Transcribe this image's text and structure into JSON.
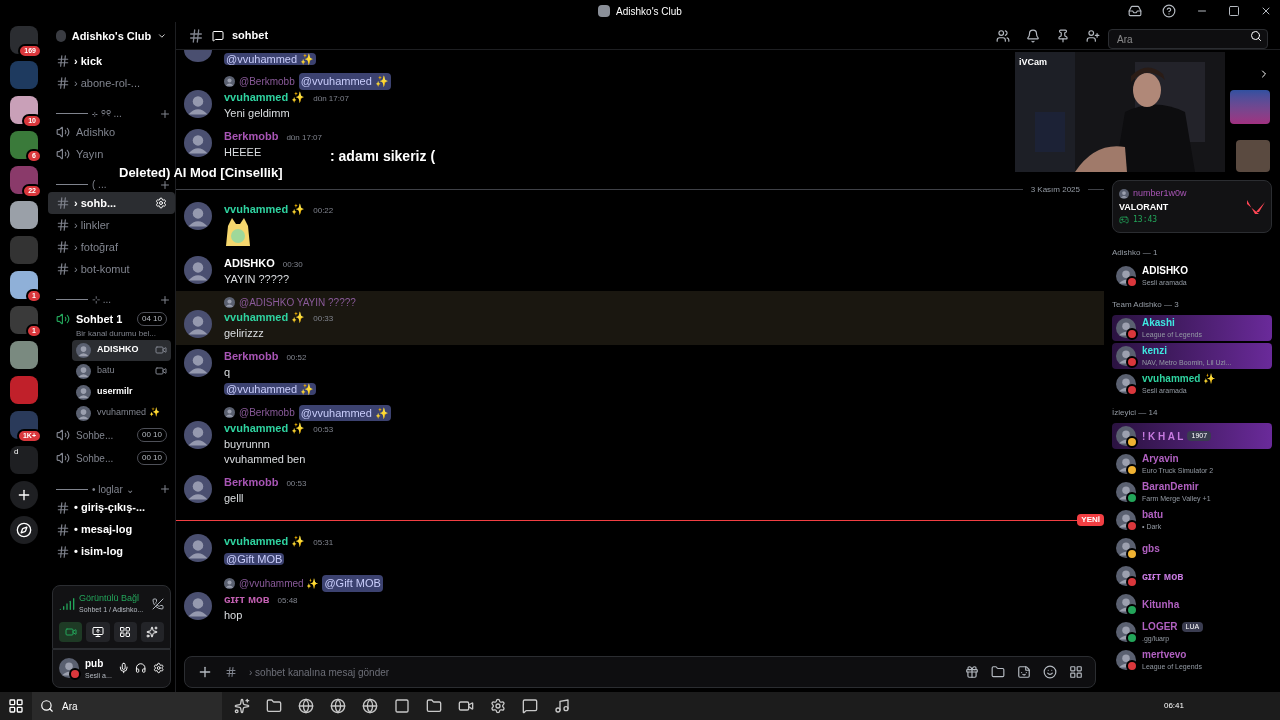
{
  "window": {
    "title": "Adishko's Club"
  },
  "servers": [
    {
      "badge": "169",
      "color": "#2b2d31"
    },
    {
      "color": "#1e3a5f"
    },
    {
      "badge": "10",
      "color": "#c9a0b8"
    },
    {
      "badge": "6",
      "color": "#3a7a3a"
    },
    {
      "badge": "22",
      "color": "#8a3a6a"
    },
    {
      "color": "#9aa0a8"
    },
    {
      "color": "#333333"
    },
    {
      "badge": "1",
      "color": "#8fb0d8"
    },
    {
      "badge": "1",
      "color": "#3a3a3a"
    },
    {
      "color": "#7a8a80"
    },
    {
      "color": "#c0202a"
    },
    {
      "badge": "1K+",
      "color": "#2a3a5a"
    }
  ],
  "folder_label": "d",
  "server_name": "Adishko's Club",
  "channels": [
    {
      "kind": "text",
      "name": "› kick",
      "bold": true,
      "selected": false
    },
    {
      "kind": "text",
      "name": "› abone-rol-...",
      "bold": false,
      "selected": false
    },
    {
      "kind": "category",
      "name": "⊹ ୨୧ ..."
    },
    {
      "kind": "voice",
      "name": "Adishko",
      "bold": false,
      "selected": false
    },
    {
      "kind": "voice",
      "name": "Yayın",
      "bold": false,
      "selected": false
    },
    {
      "kind": "category",
      "name": "( ..."
    },
    {
      "kind": "text",
      "name": "› sohb...",
      "bold": true,
      "selected": true
    },
    {
      "kind": "text",
      "name": "› linkler",
      "bold": false,
      "selected": false
    },
    {
      "kind": "text",
      "name": "› fotoğraf",
      "bold": false,
      "selected": false
    },
    {
      "kind": "text",
      "name": "› bot-komut",
      "bold": false,
      "selected": false
    },
    {
      "kind": "category",
      "name": "⊹ ..."
    },
    {
      "kind": "voicelive",
      "name": "Sohbet 1",
      "status": "Bir kanal durumu bel...",
      "count": "04",
      "limit": "10"
    },
    {
      "kind": "member",
      "name": "ADISHKO",
      "bold": true,
      "selected": true,
      "camera": true
    },
    {
      "kind": "member",
      "name": "batu",
      "bold": false,
      "selected": false,
      "camera": true
    },
    {
      "kind": "member",
      "name": "usermilr",
      "bold": true,
      "selected": false,
      "camera": false
    },
    {
      "kind": "member",
      "name": "vvuhammed ✨",
      "bold": false,
      "selected": false,
      "camera": false
    },
    {
      "kind": "voicecount",
      "name": "Sohbe...",
      "count": "00",
      "limit": "10"
    },
    {
      "kind": "voicecount",
      "name": "Sohbe...",
      "count": "00",
      "limit": "10"
    },
    {
      "kind": "category",
      "name": "• loglar ⌄"
    },
    {
      "kind": "text",
      "name": "• giriş-çıkış-...",
      "bold": true,
      "selected": false
    },
    {
      "kind": "text",
      "name": "• mesaj-log",
      "bold": true,
      "selected": false
    },
    {
      "kind": "text",
      "name": "• isim-log",
      "bold": true,
      "selected": false
    }
  ],
  "voice_panel": {
    "status": "Görüntülü Bağl",
    "channel": "Sohbet 1 / Adishko..."
  },
  "user": {
    "name": "pub",
    "status": "Sesli a..."
  },
  "header": {
    "channel": "sohbet",
    "search_placeholder": "Ara"
  },
  "messages": [
    {
      "kind": "message",
      "mention": "@vvuhammed ✨"
    },
    {
      "kind": "message",
      "reply": {
        "author": "@Berkmobb",
        "mention": "@vvuhammed ✨"
      },
      "author": "vvuhammed ✨",
      "color": "#2fd3a0",
      "time": "dün 17:07",
      "lines": [
        "Yeni geldimm"
      ]
    },
    {
      "kind": "message",
      "author": "Berkmobb",
      "color": "#a855b5",
      "time": "dün 17:07",
      "lines": [
        "HEEEE"
      ]
    },
    {
      "kind": "divider",
      "text": "3 Kasım 2025"
    },
    {
      "kind": "message",
      "author": "vvuhammed ✨",
      "color": "#2fd3a0",
      "time": "00:22",
      "sticker": true
    },
    {
      "kind": "message",
      "author": "ADISHKO",
      "color": "#ffffff",
      "time": "00:30",
      "lines": [
        "YAYIN ?????"
      ]
    },
    {
      "kind": "message",
      "reply": {
        "author": "@ADISHKO YAYIN ?????"
      },
      "author": "vvuhammed ✨",
      "color": "#2fd3a0",
      "time": "00:33",
      "lines": [
        "gelirizzz"
      ],
      "highlighted": true
    },
    {
      "kind": "message",
      "author": "Berkmobb",
      "color": "#a855b5",
      "time": "00:52",
      "lines": [
        "q"
      ],
      "mention": "@vvuhammed ✨"
    },
    {
      "kind": "message",
      "reply": {
        "author": "@Berkmobb",
        "mention": "@vvuhammed ✨"
      },
      "author": "vvuhammed ✨",
      "color": "#2fd3a0",
      "time": "00:53",
      "lines": [
        "buyrunnn",
        "vvuhammed ben"
      ]
    },
    {
      "kind": "message",
      "author": "Berkmobb",
      "color": "#a855b5",
      "time": "00:53",
      "lines": [
        "gelll"
      ]
    },
    {
      "kind": "new",
      "text": "YENİ"
    },
    {
      "kind": "message",
      "author": "vvuhammed ✨",
      "color": "#2fd3a0",
      "time": "05:31",
      "mention": "@Gift MOB"
    },
    {
      "kind": "message",
      "reply": {
        "author": "@vvuhammed ✨",
        "mention": "@Gift MOB"
      },
      "author": "ɢɪғᴛ ᴍᴏʙ",
      "color": "#c15fb0",
      "time": "05:48",
      "lines": [
        "hop"
      ]
    }
  ],
  "composer": {
    "placeholder": "› sohbet kanalına mesaj gönder"
  },
  "overlay": {
    "line1": ": adamı sikeriz (",
    "line2": "Deleted) AI Mod [Cinsellik]"
  },
  "webcam": {
    "label": "iVCam"
  },
  "activity": {
    "user": "number1w0w",
    "game": "VALORANT",
    "time": "13:43"
  },
  "member_groups": [
    {
      "title": "Adishko — 1",
      "members": [
        {
          "kind": "owner",
          "name": "ADISHKO",
          "activity": "Sesli aramada",
          "color": "#da373c",
          "banner": false
        }
      ]
    },
    {
      "title": "Team Adishko — 3",
      "members": [
        {
          "kind": "team",
          "name": "Akashi",
          "activity": "League of Legends",
          "color": "#da373c",
          "banner": true
        },
        {
          "kind": "team",
          "name": "kenzi",
          "activity": "NAV, Metro Boomin, Lil Uzi...",
          "color": "#da373c",
          "banner": true
        },
        {
          "kind": "booster",
          "name": "vvuhammed ✨",
          "activity": "Sesli aramada",
          "color": "#da373c",
          "banner": false
        }
      ]
    },
    {
      "title": "İzleyici — 14",
      "members": [
        {
          "kind": "vip",
          "name": "! K H A L",
          "tag": "1907",
          "color": "#f0b232",
          "banner": true
        },
        {
          "kind": "viewer",
          "name": "Aryavin",
          "activity": "Euro Truck Simulator 2",
          "color": "#f0b232",
          "banner": false
        },
        {
          "kind": "viewer",
          "name": "BaranDemir",
          "activity": "Farm Merge Valley +1",
          "color": "#23a55a",
          "banner": false
        },
        {
          "kind": "viewer",
          "name": "batu",
          "activity": "• Dark",
          "color": "#da373c",
          "banner": false
        },
        {
          "kind": "viewer",
          "name": "gbs",
          "color": "#f0b232",
          "banner": false
        },
        {
          "kind": "vip",
          "name": "ɢɪғᴛ ᴍᴏʙ",
          "color": "#da373c",
          "banner": false
        },
        {
          "kind": "viewer",
          "name": "Kitunha",
          "color": "#23a55a",
          "banner": false
        },
        {
          "kind": "viewer",
          "name": "LOGER",
          "tag": "LUA",
          "activity": ".gg/luarp",
          "color": "#23a55a",
          "banner": false
        },
        {
          "kind": "viewer",
          "name": "mertvevo",
          "activity": "League of Legends",
          "color": "#da373c",
          "banner": false
        }
      ]
    }
  ],
  "taskbar": {
    "search": "Ara",
    "time": "06:41"
  }
}
